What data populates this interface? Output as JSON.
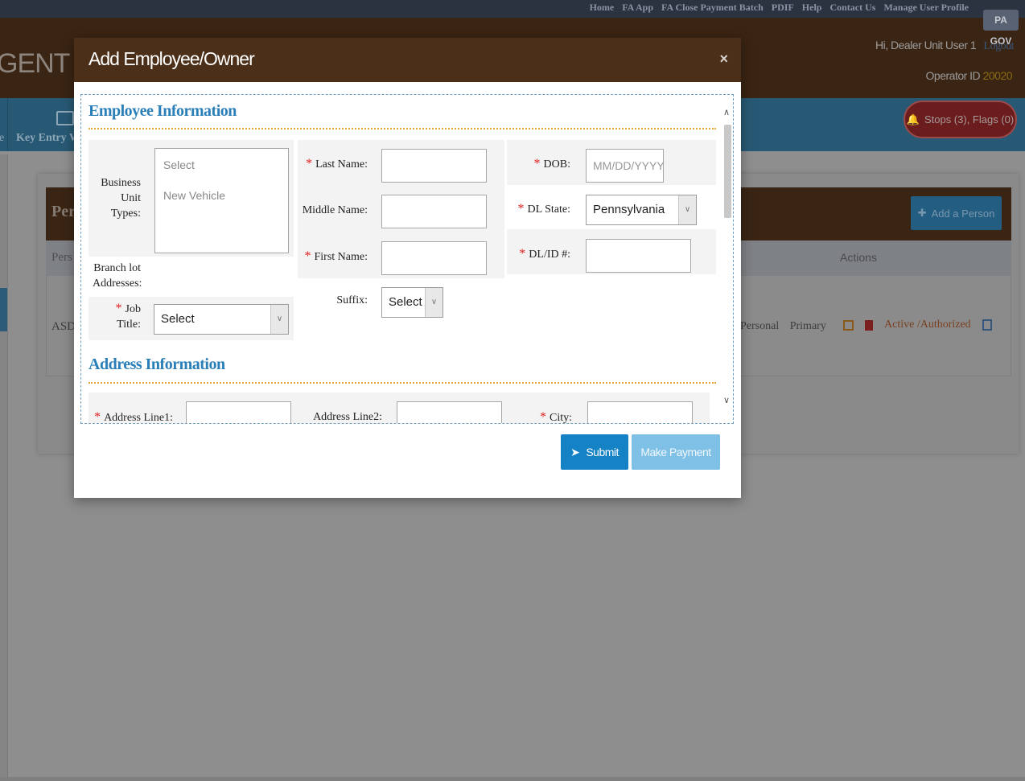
{
  "header": {
    "top_links": [
      "Home",
      "FA App",
      "FA Close Payment Batch",
      "PDIF",
      "Help",
      "Contact Us",
      "Manage User Profile"
    ],
    "logo_text": "PA GOV",
    "app_title_fragment": "GENT SE",
    "greeting": "Hi, Dealer Unit User 1",
    "logout_label": "Logout",
    "operator_label": "Operator ID",
    "operator_id": "20020",
    "stops_flags": "Stops (3), Flags (0)"
  },
  "nav": {
    "key_entry_label": "Key Entry W",
    "edge_label": "e"
  },
  "background_panel": {
    "title_fragment": "Pers",
    "add_person_label": "Add a Person",
    "col_pers": "Pers",
    "col_actions": "Actions",
    "row_name_fragment": "ASD",
    "row_type": "Personal  Primary",
    "row_status": "Active  /Authorized"
  },
  "modal": {
    "title": "Add Employee/Owner",
    "close_symbol": "×",
    "employee_section_title": "Employee Information",
    "address_section_title": "Address Information",
    "business_unit_types_label": "Business Unit Types:",
    "business_unit_options": [
      "Select",
      "New Vehicle"
    ],
    "branch_lot_label": "Branch lot Addresses:",
    "job_title_label": "Job Title:",
    "job_title_value": "Select",
    "last_name_label": "Last Name:",
    "middle_name_label": "Middle Name:",
    "first_name_label": "First Name:",
    "suffix_label": "Suffix:",
    "suffix_value": "Select",
    "dob_label": "DOB:",
    "dob_placeholder": "MM/DD/YYYY",
    "dl_state_label": "DL State:",
    "dl_state_value": "Pennsylvania",
    "dl_id_label": "DL/ID #:",
    "address_line1_label": "Address Line1:",
    "address_line2_label": "Address Line2:",
    "city_label": "City:",
    "submit_label": "Submit",
    "make_payment_label": "Make Payment"
  },
  "colors": {
    "modal_header": "#4b2f18",
    "section_title": "#2b7fb8",
    "section_rule": "#e8a33a",
    "submit": "#1482c4",
    "make_payment": "#7fc0e6",
    "required": "#e02020"
  }
}
